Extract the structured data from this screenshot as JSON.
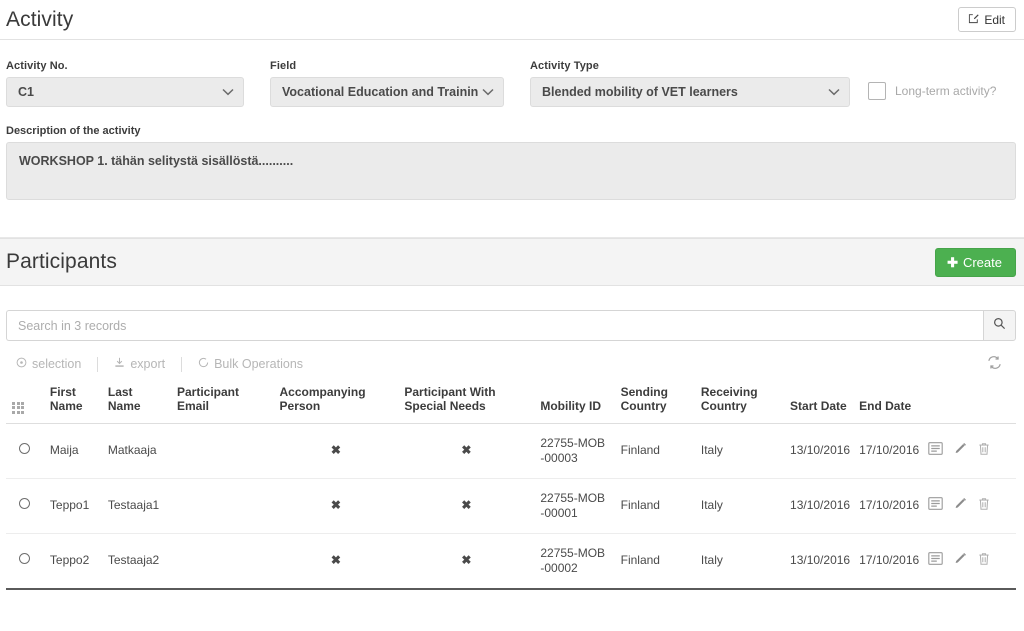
{
  "activity": {
    "title": "Activity",
    "edit_label": "Edit",
    "edit_icon": "pencil-square-icon",
    "fields": {
      "activity_no": {
        "label": "Activity No.",
        "value": "C1"
      },
      "field": {
        "label": "Field",
        "value": "Vocational Education and Trainin"
      },
      "activity_type": {
        "label": "Activity Type",
        "value": "Blended mobility of VET learners"
      }
    },
    "long_term": {
      "label": "Long-term activity?",
      "checked": false
    },
    "description": {
      "label": "Description of the activity",
      "value": "WORKSHOP 1. tähän selitystä sisällöstä.........."
    }
  },
  "participants": {
    "title": "Participants",
    "create_label": "Create",
    "search": {
      "placeholder": "Search in 3 records",
      "value": "",
      "icon": "search-icon"
    },
    "toolbar": {
      "selection_label": "selection",
      "selection_icon": "target-circle-icon",
      "export_label": "export",
      "export_icon": "download-icon",
      "bulk_label": "Bulk Operations",
      "bulk_icon": "circle-icon",
      "refresh_icon": "refresh-icon"
    },
    "columns": [
      "",
      "First Name",
      "Last Name",
      "Participant Email",
      "Accompanying Person",
      "Participant With Special Needs",
      "Mobility ID",
      "Sending Country",
      "Receiving Country",
      "Start Date",
      "End Date",
      ""
    ],
    "rows": [
      {
        "first_name": "Maija",
        "last_name": "Matkaaja",
        "email": "",
        "accompanying_person": "✖",
        "special_needs": "✖",
        "mobility_id": "22755-MOB-00003",
        "sending_country": "Finland",
        "receiving_country": "Italy",
        "start_date": "13/10/2016",
        "end_date": "17/10/2016"
      },
      {
        "first_name": "Teppo1",
        "last_name": "Testaaja1",
        "email": "",
        "accompanying_person": "✖",
        "special_needs": "✖",
        "mobility_id": "22755-MOB-00001",
        "sending_country": "Finland",
        "receiving_country": "Italy",
        "start_date": "13/10/2016",
        "end_date": "17/10/2016"
      },
      {
        "first_name": "Teppo2",
        "last_name": "Testaaja2",
        "email": "",
        "accompanying_person": "✖",
        "special_needs": "✖",
        "mobility_id": "22755-MOB-00002",
        "sending_country": "Finland",
        "receiving_country": "Italy",
        "start_date": "13/10/2016",
        "end_date": "17/10/2016"
      }
    ],
    "row_actions": {
      "details_icon": "list-details-icon",
      "edit_icon": "pencil-icon",
      "delete_icon": "trash-icon"
    }
  },
  "colors": {
    "create_green": "#4cb050",
    "band_grey": "#f4f4f4",
    "field_grey": "#ebebeb"
  }
}
